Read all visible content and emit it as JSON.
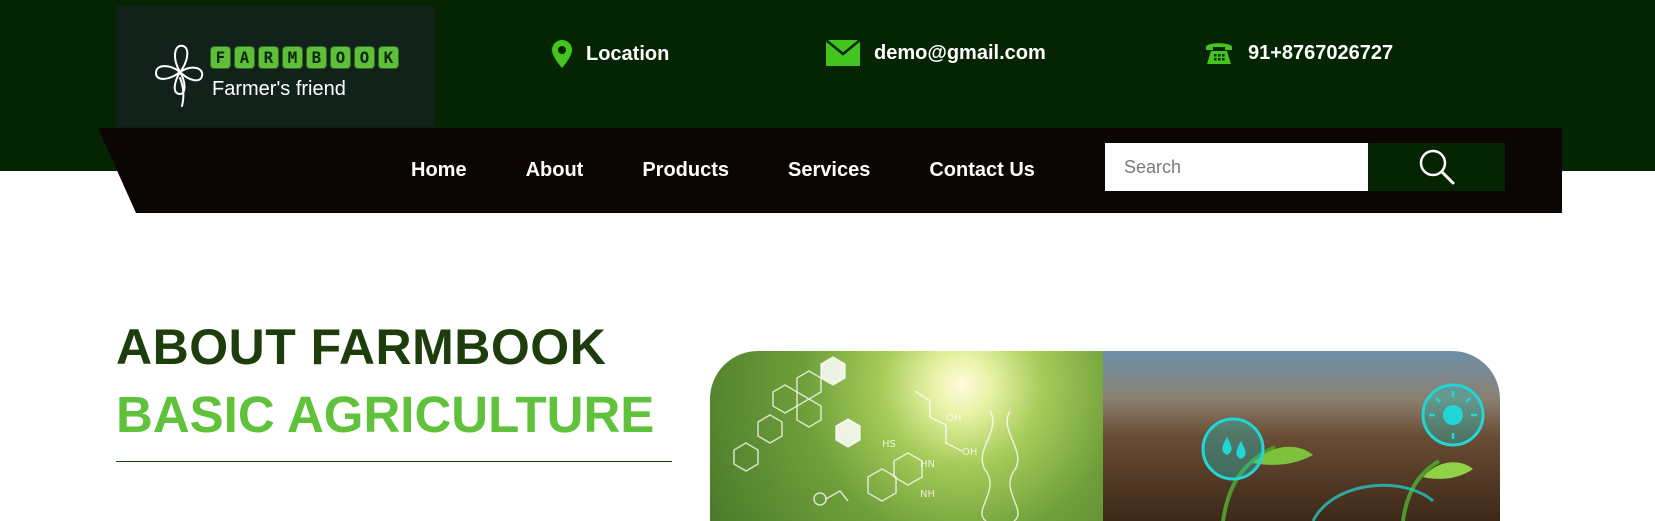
{
  "brand": {
    "letters": [
      "F",
      "A",
      "R",
      "M",
      "B",
      "O",
      "O",
      "K"
    ],
    "tagline": "Farmer's friend"
  },
  "contacts": {
    "location": "Location",
    "email": "demo@gmail.com",
    "phone": "91+8767026727"
  },
  "nav": {
    "items": [
      "Home",
      "About",
      "Products",
      "Services",
      "Contact Us"
    ]
  },
  "search": {
    "placeholder": "Search"
  },
  "about": {
    "title": "ABOUT FARMBOOK",
    "subtitle": "BASIC AGRICULTURE"
  },
  "colors": {
    "header_bg": "#052402",
    "nav_bg": "#0b0604",
    "accent": "#5fc23a",
    "title": "#1d3d0d"
  },
  "icons": {
    "location": "map-pin-icon",
    "email": "envelope-icon",
    "phone": "telephone-icon",
    "search": "magnifier-icon",
    "logo": "clover-icon"
  }
}
